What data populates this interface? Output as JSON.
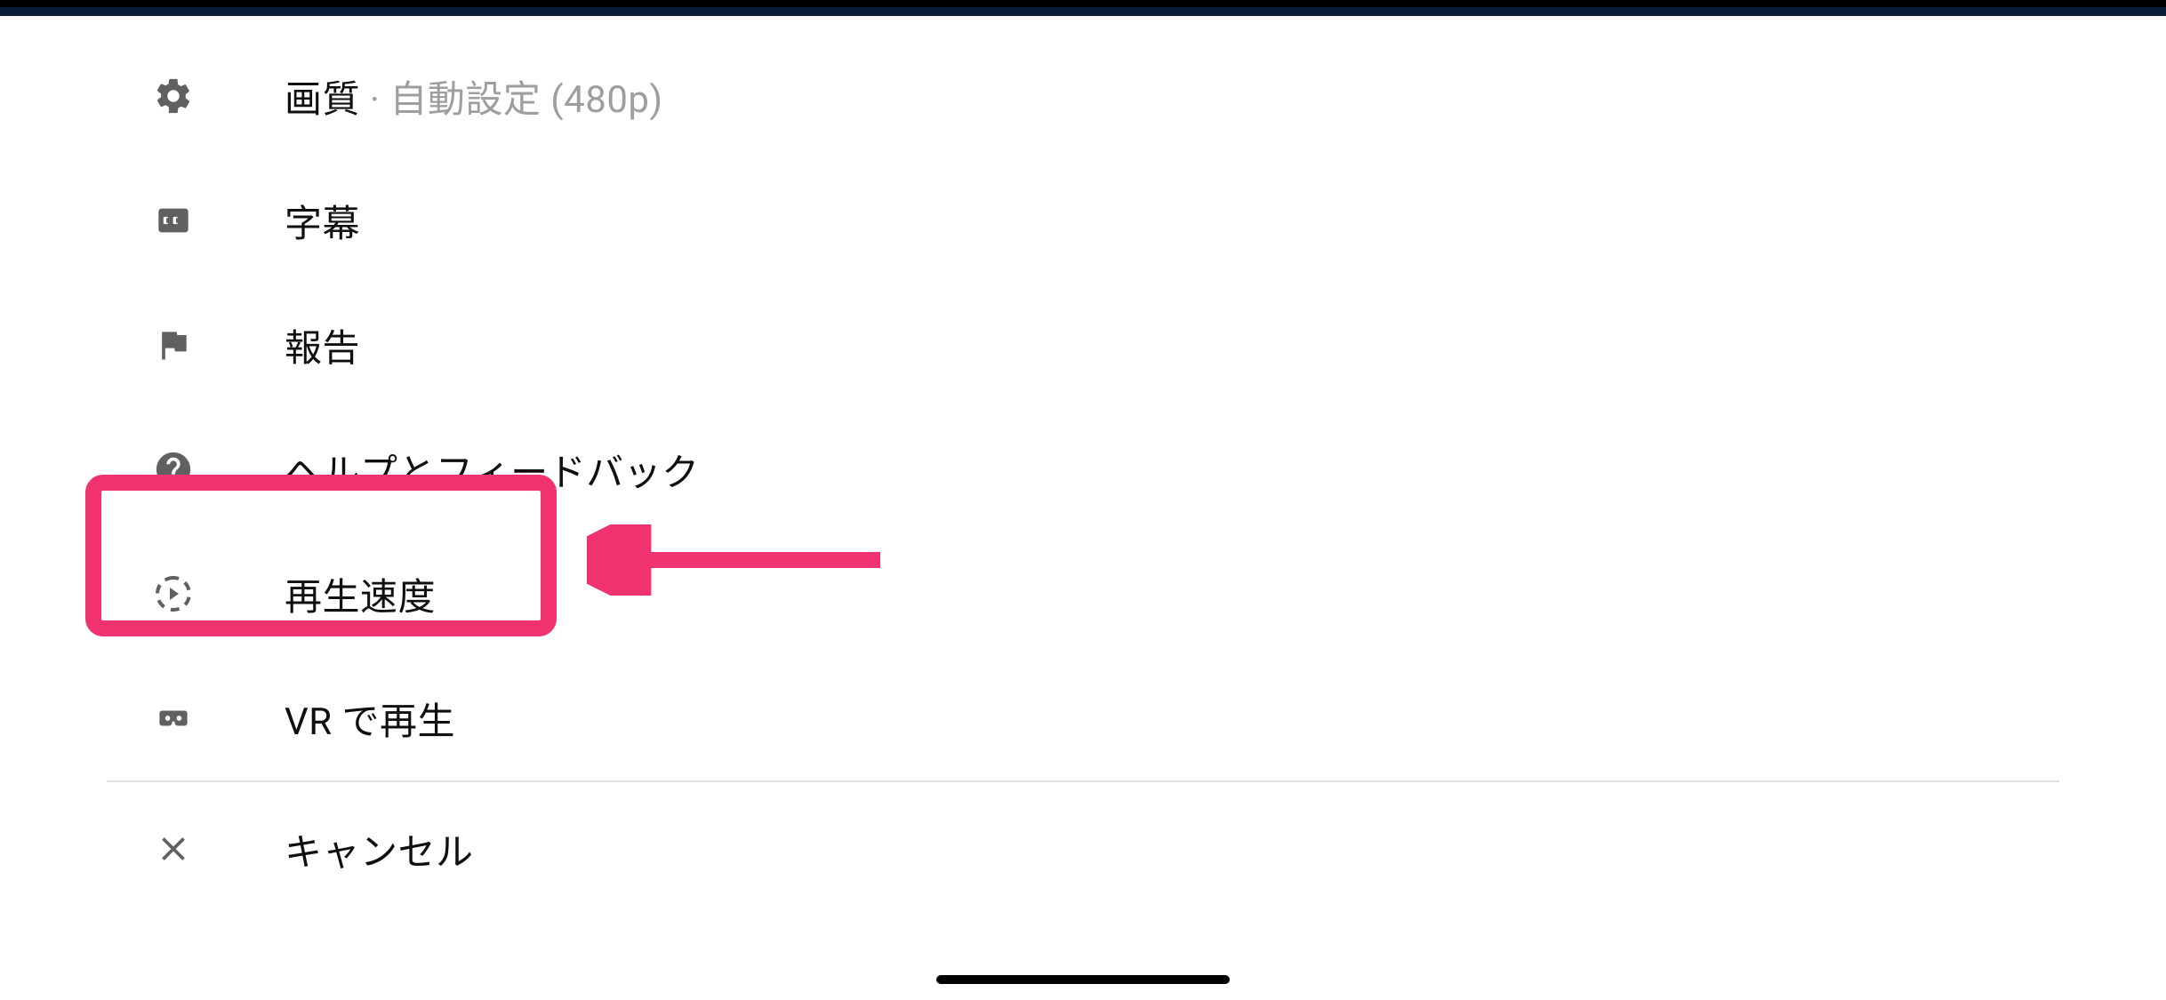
{
  "menu": {
    "quality": {
      "label": "画質",
      "separator": " · ",
      "value": "自動設定 (480p)"
    },
    "subtitles": {
      "label": "字幕"
    },
    "report": {
      "label": "報告"
    },
    "help": {
      "label": "ヘルプとフィードバック"
    },
    "speed": {
      "label": "再生速度"
    },
    "vr": {
      "label": "VR で再生"
    },
    "cancel": {
      "label": "キャンセル"
    }
  },
  "annotation": {
    "color": "#f0326e"
  }
}
